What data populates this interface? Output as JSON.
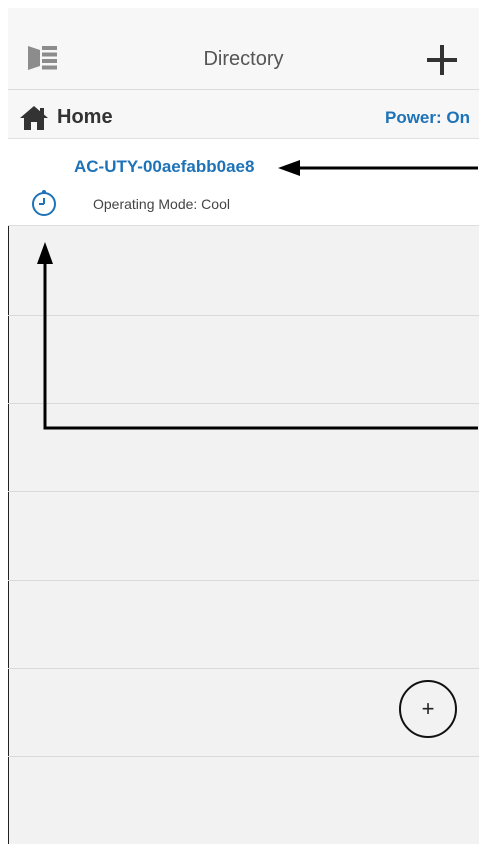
{
  "header": {
    "title": "Directory",
    "menu_icon": "menu-icon",
    "add_icon": "plus-icon"
  },
  "group": {
    "name": "Home",
    "icon": "home-icon",
    "power_label": "Power: On"
  },
  "device": {
    "name": "AC-UTY-00aefabb0ae8",
    "mode_label": "Operating Mode: Cool",
    "status_icon": "timer-icon"
  },
  "fab": {
    "label": "+",
    "icon": "add-circle-icon"
  },
  "colors": {
    "accent": "#1e73b8",
    "background": "#f2f2f2",
    "text": "#333333"
  }
}
